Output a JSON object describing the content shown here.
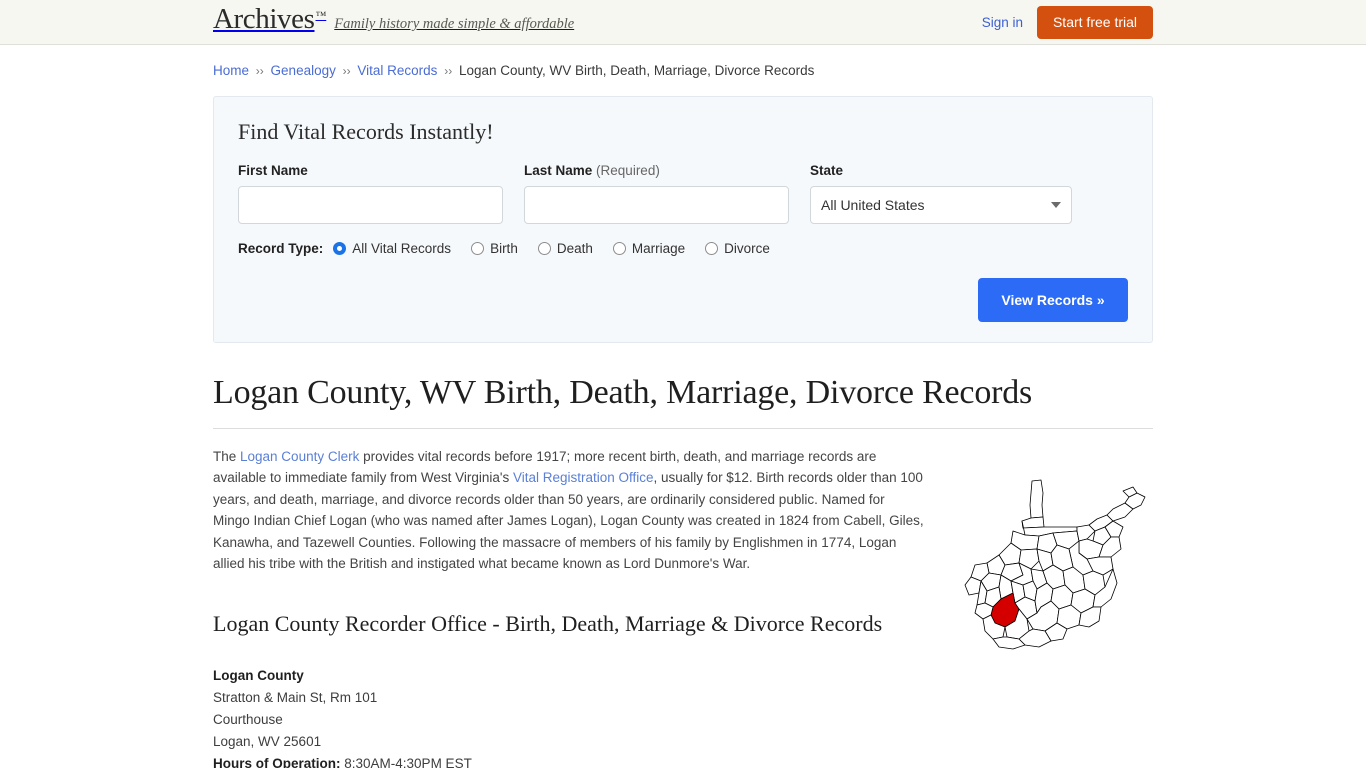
{
  "header": {
    "logo_word": "Archives",
    "logo_tm": "™",
    "tagline": "Family history made simple & affordable",
    "signin_label": "Sign in",
    "trial_label": "Start free trial",
    "trial_color": "#d4500e",
    "background": "#f7f7f2"
  },
  "breadcrumb": {
    "separator": "››",
    "items": [
      {
        "label": "Home",
        "link": true
      },
      {
        "label": "Genealogy",
        "link": true
      },
      {
        "label": "Vital Records",
        "link": true
      },
      {
        "label": "Logan County, WV Birth, Death, Marriage, Divorce Records",
        "link": false
      }
    ]
  },
  "search_panel": {
    "title": "Find Vital Records Instantly!",
    "first_name": {
      "label": "First Name",
      "value": "",
      "placeholder": ""
    },
    "last_name": {
      "label": "Last Name",
      "required_note": "(Required)",
      "value": "",
      "placeholder": ""
    },
    "state": {
      "label": "State",
      "selected": "All United States",
      "options": [
        "All United States"
      ]
    },
    "record_type": {
      "label": "Record Type:",
      "selected": "All Vital Records",
      "options": [
        "All Vital Records",
        "Birth",
        "Death",
        "Marriage",
        "Divorce"
      ]
    },
    "submit_label": "View Records »",
    "submit_color": "#2c6bf6",
    "background": "#f6f9fb"
  },
  "article": {
    "title": "Logan County, WV Birth, Death, Marriage, Divorce Records",
    "paragraph": {
      "part1": "The ",
      "link1": "Logan County Clerk",
      "part2": " provides vital records before 1917; more recent birth, death, and marriage records are available to immediate family from West Virginia's ",
      "link2": "Vital Registration Office",
      "part3": ", usually for $12. Birth records older than 100 years, and death, marriage, and divorce records older than 50 years, are ordinarily considered public. Named for Mingo Indian Chief Logan (who was named after James Logan), Logan County was created in 1824 from Cabell, Giles, Kanawha, and Tazewell Counties. Following the massacre of members of his family by Englishmen in 1774, Logan allied his tribe with the British and instigated what became known as Lord Dunmore's War."
    },
    "map": {
      "alt": "Map of West Virginia highlighting Logan County",
      "highlight_color": "#d40000",
      "outline_color": "#000000"
    },
    "section_title": "Logan County Recorder Office - Birth, Death, Marriage & Divorce Records",
    "address": {
      "name": "Logan County",
      "street": "Stratton & Main St, Rm 101",
      "building": "Courthouse",
      "city_state_zip": "Logan, WV 25601",
      "hours_label": "Hours of Operation:",
      "hours_value": "8:30AM-4:30PM EST"
    }
  }
}
